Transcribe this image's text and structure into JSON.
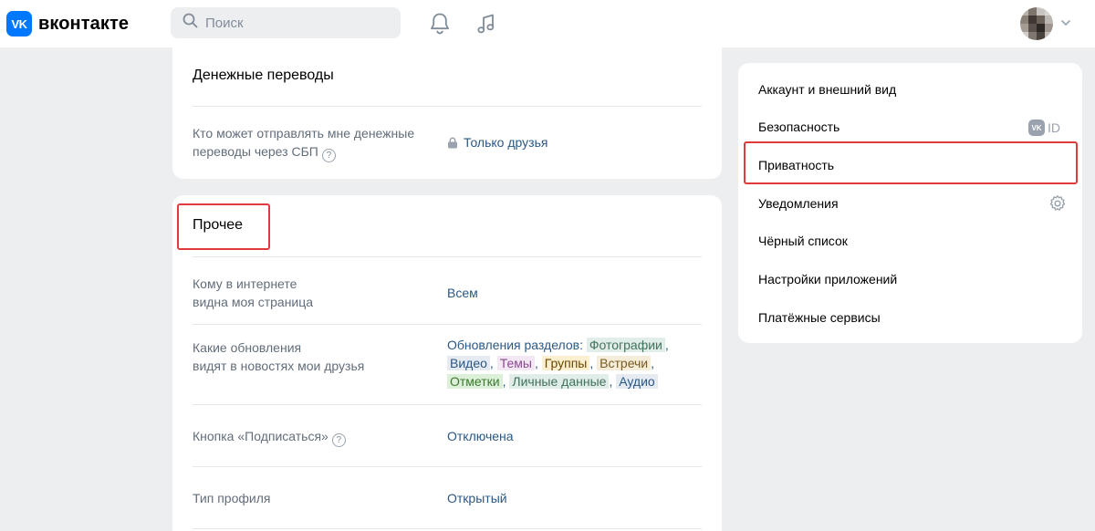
{
  "header": {
    "logo_badge": "VK",
    "logo_text": "вконтакте",
    "search_placeholder": "Поиск"
  },
  "money_card": {
    "title": "Денежные переводы",
    "row_label_line1": "Кто может отправлять мне денежные",
    "row_label_line2": "переводы через СБП",
    "row_value": "Только друзья"
  },
  "other_card": {
    "title": "Прочее",
    "rows": [
      {
        "label_line1": "Кому в интернете",
        "label_line2": "видна моя страница",
        "value": "Всем"
      },
      {
        "label_line1": "Какие обновления",
        "label_line2": "видят в новостях мои друзья"
      },
      {
        "label": "Кнопка «Подписаться»",
        "value": "Отключена"
      },
      {
        "label": "Тип профиля",
        "value": "Открытый"
      }
    ],
    "updates": {
      "prefix": "Обновления разделов:",
      "tags": [
        "Фотографии",
        "Видео",
        "Темы",
        "Группы",
        "Встречи",
        "Отметки",
        "Личные данные",
        "Аудио"
      ]
    }
  },
  "menu": {
    "items": [
      "Аккаунт и внешний вид",
      "Безопасность",
      "Приватность",
      "Уведомления",
      "Чёрный список",
      "Настройки приложений",
      "Платёжные сервисы"
    ],
    "vkid_badge": "VK",
    "vkid_text": "ID"
  },
  "colors": {
    "accent": "#0077ff",
    "link": "#2a5885",
    "highlight": "#e03a3a",
    "background": "#edeef0"
  },
  "icons": [
    "vk-logo-icon",
    "search-icon",
    "bell-icon",
    "music-icon",
    "chevron-down-icon",
    "lock-icon",
    "help-icon",
    "vk-id-icon",
    "gear-icon"
  ]
}
